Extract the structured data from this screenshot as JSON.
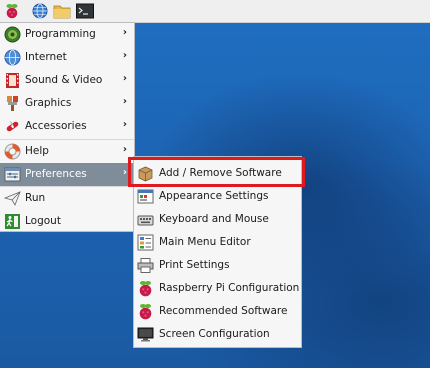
{
  "menu": {
    "items": [
      {
        "label": "Programming",
        "icon": "programming-icon",
        "submenu": true
      },
      {
        "label": "Internet",
        "icon": "globe-icon",
        "submenu": true
      },
      {
        "label": "Sound & Video",
        "icon": "film-icon",
        "submenu": true
      },
      {
        "label": "Graphics",
        "icon": "paintbrush-icon",
        "submenu": true
      },
      {
        "label": "Accessories",
        "icon": "swiss-knife-icon",
        "submenu": true
      },
      {
        "label": "Help",
        "icon": "lifebuoy-icon",
        "submenu": true
      },
      {
        "label": "Preferences",
        "icon": "preferences-icon",
        "submenu": true,
        "active": true
      },
      {
        "label": "Run",
        "icon": "paper-plane-icon",
        "submenu": false
      },
      {
        "label": "Logout",
        "icon": "exit-icon",
        "submenu": false
      }
    ],
    "arrow_glyph": "›"
  },
  "submenu": {
    "items": [
      {
        "label": "Add / Remove Software",
        "icon": "package-icon"
      },
      {
        "label": "Appearance Settings",
        "icon": "appearance-icon"
      },
      {
        "label": "Keyboard and Mouse",
        "icon": "keyboard-icon"
      },
      {
        "label": "Main Menu Editor",
        "icon": "menu-editor-icon"
      },
      {
        "label": "Print Settings",
        "icon": "printer-icon"
      },
      {
        "label": "Raspberry Pi Configuration",
        "icon": "raspberry-icon"
      },
      {
        "label": "Recommended Software",
        "icon": "raspberry-icon"
      },
      {
        "label": "Screen Configuration",
        "icon": "monitor-icon"
      }
    ]
  },
  "taskbar": {
    "icons": [
      "raspberry-menu-icon",
      "web-browser-icon",
      "file-manager-icon",
      "terminal-icon"
    ]
  },
  "colors": {
    "highlight": "#e0191f",
    "active_bg": "#7f8c99",
    "desktop": "#1d62b0"
  }
}
